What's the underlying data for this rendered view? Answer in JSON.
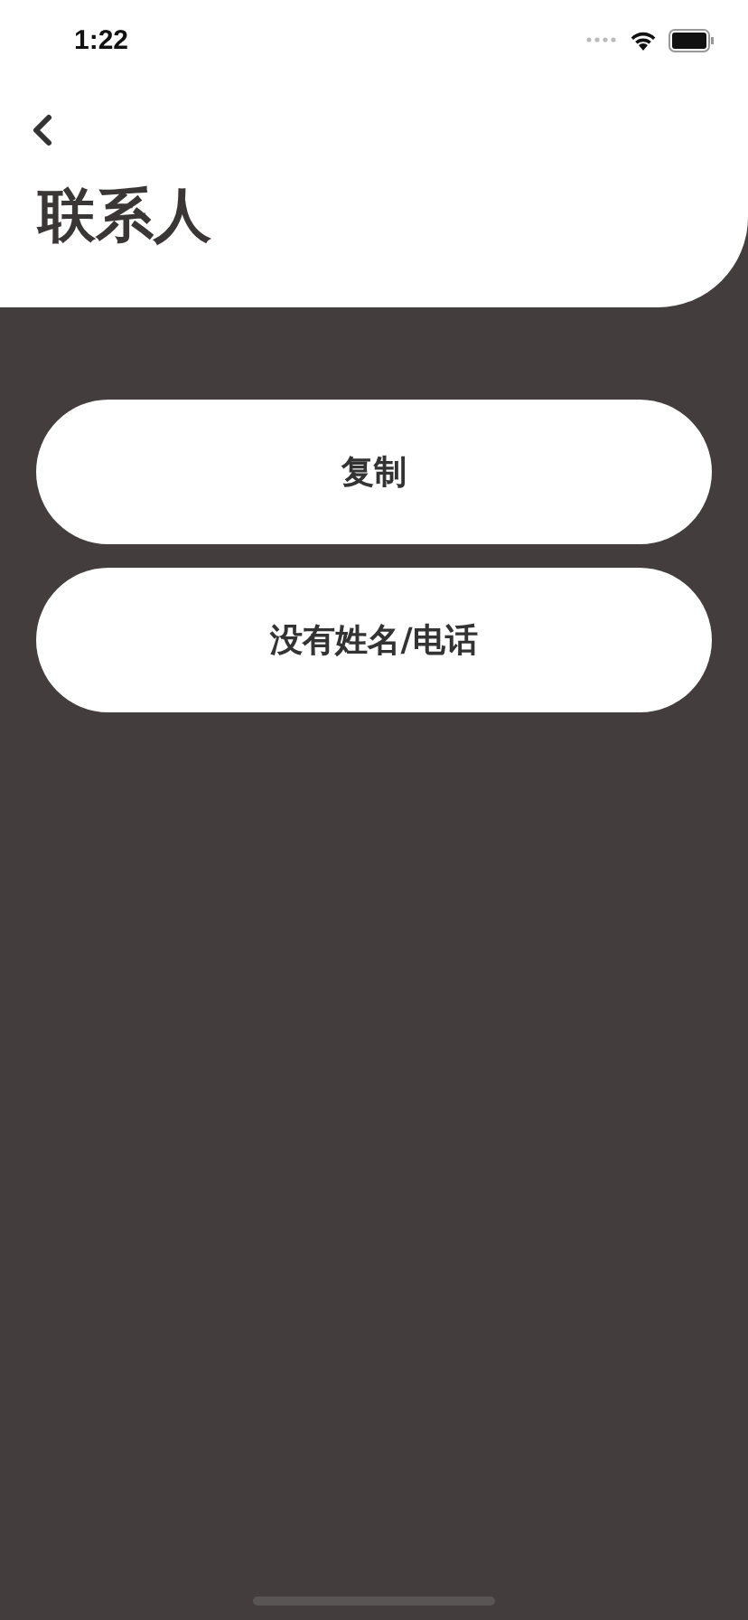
{
  "status_bar": {
    "time": "1:22"
  },
  "header": {
    "title": "联系人"
  },
  "buttons": [
    {
      "label": "复制"
    },
    {
      "label": "没有姓名/电话"
    }
  ]
}
